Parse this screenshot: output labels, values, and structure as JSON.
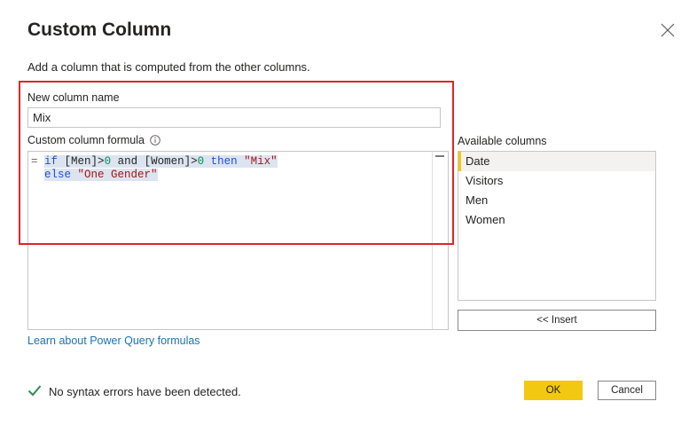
{
  "dialog": {
    "title": "Custom Column",
    "subtitle": "Add a column that is computed from the other columns.",
    "close_icon": "close-icon"
  },
  "name_field": {
    "label": "New column name",
    "value": "Mix"
  },
  "formula": {
    "label": "Custom column formula",
    "info_icon": "info-icon",
    "line1": {
      "eq": "=",
      "if": "if",
      "men": " [Men]>",
      "zero1": "0",
      "and": " and [Women]>",
      "zero2": "0",
      "then": "then",
      "mix": " \"Mix\""
    },
    "line2": {
      "else": "else",
      "str": " \"One Gender\""
    }
  },
  "available_columns": {
    "label": "Available columns",
    "items": [
      "Date",
      "Visitors",
      "Men",
      "Women"
    ],
    "selected": "Date"
  },
  "buttons": {
    "insert": "<< Insert",
    "ok": "OK",
    "cancel": "Cancel"
  },
  "learn_link": "Learn about Power Query formulas",
  "status": {
    "text": "No syntax errors have been detected.",
    "icon": "check-icon"
  },
  "colors": {
    "accent": "#f2c811",
    "highlight_border": "#e0232a",
    "link": "#1a73b8",
    "check": "#2e8b57"
  }
}
